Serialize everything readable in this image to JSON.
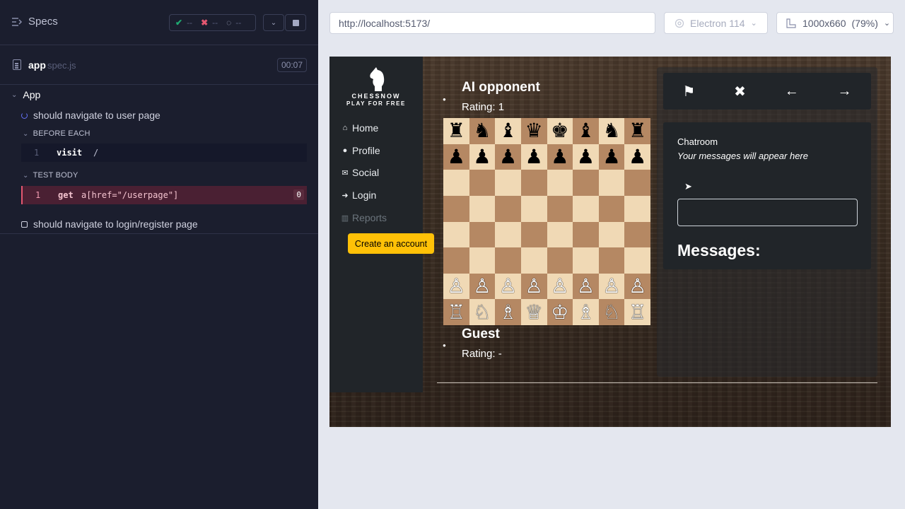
{
  "runner": {
    "specs_label": "Specs",
    "stats": {
      "passed": "--",
      "failed": "--",
      "pending": "--"
    },
    "spec": {
      "name": "app",
      "ext": "spec.js",
      "time": "00:07"
    },
    "suite": "App",
    "tests": [
      {
        "title": "should navigate to user page",
        "state": "running"
      },
      {
        "title": "should navigate to login/register page",
        "state": "pending"
      }
    ],
    "before_each_label": "BEFORE EACH",
    "test_body_label": "TEST BODY",
    "commands": [
      {
        "num": "1",
        "name": "visit",
        "arg": "/"
      },
      {
        "num": "1",
        "name": "get",
        "arg": "a[href=\"/userpage\"]",
        "count": "0"
      }
    ]
  },
  "browser": {
    "url": "http://localhost:5173/",
    "browser_name": "Electron 114",
    "viewport": "1000x660",
    "zoom": "(79%)"
  },
  "app": {
    "logo_title": "CHESSNOW",
    "logo_sub": "PLAY FOR FREE",
    "nav": [
      "Home",
      "Profile",
      "Social",
      "Login",
      "Reports"
    ],
    "create_account": "Create an account",
    "opponent": {
      "name": "AI opponent",
      "rating": "Rating: 1"
    },
    "player": {
      "name": "Guest",
      "rating": "Rating: -"
    },
    "chat": {
      "title": "Chatroom",
      "empty": "Your messages will appear here",
      "messages_heading": "Messages:"
    },
    "board_rows": [
      [
        "♜",
        "♞",
        "♝",
        "♛",
        "♚",
        "♝",
        "♞",
        "♜"
      ],
      [
        "♟",
        "♟",
        "♟",
        "♟",
        "♟",
        "♟",
        "♟",
        "♟"
      ],
      [
        "",
        "",
        "",
        "",
        "",
        "",
        "",
        ""
      ],
      [
        "",
        "",
        "",
        "",
        "",
        "",
        "",
        ""
      ],
      [
        "",
        "",
        "",
        "",
        "",
        "",
        "",
        ""
      ],
      [
        "",
        "",
        "",
        "",
        "",
        "",
        "",
        ""
      ],
      [
        "♙",
        "♙",
        "♙",
        "♙",
        "♙",
        "♙",
        "♙",
        "♙"
      ],
      [
        "♖",
        "♘",
        "♗",
        "♕",
        "♔",
        "♗",
        "♘",
        "♖"
      ]
    ]
  }
}
